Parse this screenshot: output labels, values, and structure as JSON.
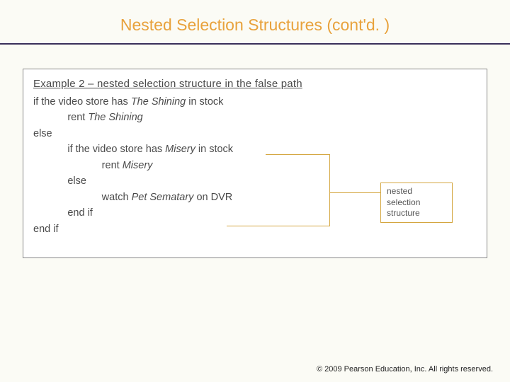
{
  "title": "Nested Selection Structures (cont'd. )",
  "example": {
    "heading": "Example 2 – nested selection structure in the false path",
    "l1a": "if the video store has ",
    "l1b": "The Shining",
    "l1c": " in stock",
    "l2a": "            rent ",
    "l2b": "The Shining",
    "l3": "else",
    "l4a": "            if the video store has ",
    "l4b": "Misery",
    "l4c": " in stock",
    "l5a": "                        rent ",
    "l5b": "Misery",
    "l6": "            else",
    "l7a": "                        watch ",
    "l7b": "Pet Sematary",
    "l7c": " on DVR",
    "l8": "            end if",
    "l9": "end if"
  },
  "callout": {
    "line1": "nested selection",
    "line2": "structure"
  },
  "footer": "2009 Pearson Education, Inc.  All rights reserved."
}
